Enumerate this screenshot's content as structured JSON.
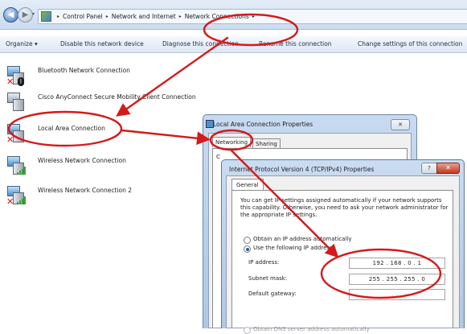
{
  "address_bar": {
    "back_glyph": "◀",
    "forward_glyph": "▶",
    "history_glyph": "▾",
    "crumbs": [
      "Control Panel",
      "Network and Internet",
      "Network Connections"
    ],
    "separator": "▸"
  },
  "toolbar": {
    "organize": "Organize ▾",
    "disable": "Disable this network device",
    "diagnose": "Diagnose this connection",
    "rename": "Rename this connection",
    "change": "Change settings of this connection"
  },
  "connections": [
    {
      "label": "Bluetooth Network Connection",
      "icon": "bluetooth-icon",
      "status": "disconnected"
    },
    {
      "label": "Cisco AnyConnect Secure Mobility Client Connection",
      "icon": "vpn-adapter-icon",
      "status": "disabled"
    },
    {
      "label": "Local Area Connection",
      "icon": "lan-adapter-icon",
      "status": "disconnected"
    },
    {
      "label": "Wireless Network Connection",
      "icon": "wireless-signal-icon",
      "status": "connected"
    },
    {
      "label": "Wireless Network Connection 2",
      "icon": "wireless-signal-icon",
      "status": "disconnected"
    }
  ],
  "properties_dialog": {
    "title": "Local Area Connection Properties",
    "close_glyph": "✕",
    "tabs": [
      "Networking",
      "Sharing"
    ],
    "partial_labels": [
      "C",
      "T"
    ]
  },
  "ipv4_dialog": {
    "title": "Internet Protocol Version 4 (TCP/IPv4) Properties",
    "help_glyph": "?",
    "close_glyph": "✕",
    "tab": "General",
    "description": "You can get IP settings assigned automatically if your network supports this capability. Otherwise, you need to ask your network administrator for the appropriate IP settings.",
    "radio_auto_ip": "Obtain an IP address automatically",
    "radio_manual_ip": "Use the following IP address:",
    "ip_label": "IP address:",
    "ip_value": "192 . 168 .   0 .   1",
    "mask_label": "Subnet mask:",
    "mask_value": "255 . 255 . 255 .   0",
    "gateway_label": "Default gateway:",
    "gateway_value": ".       .       .",
    "radio_auto_dns": "Obtain DNS server address automatically"
  },
  "colors": {
    "annotation_red": "#d41a1a",
    "window_frame": "#b9cfe8",
    "selected_radio": "#2a5d9a"
  }
}
